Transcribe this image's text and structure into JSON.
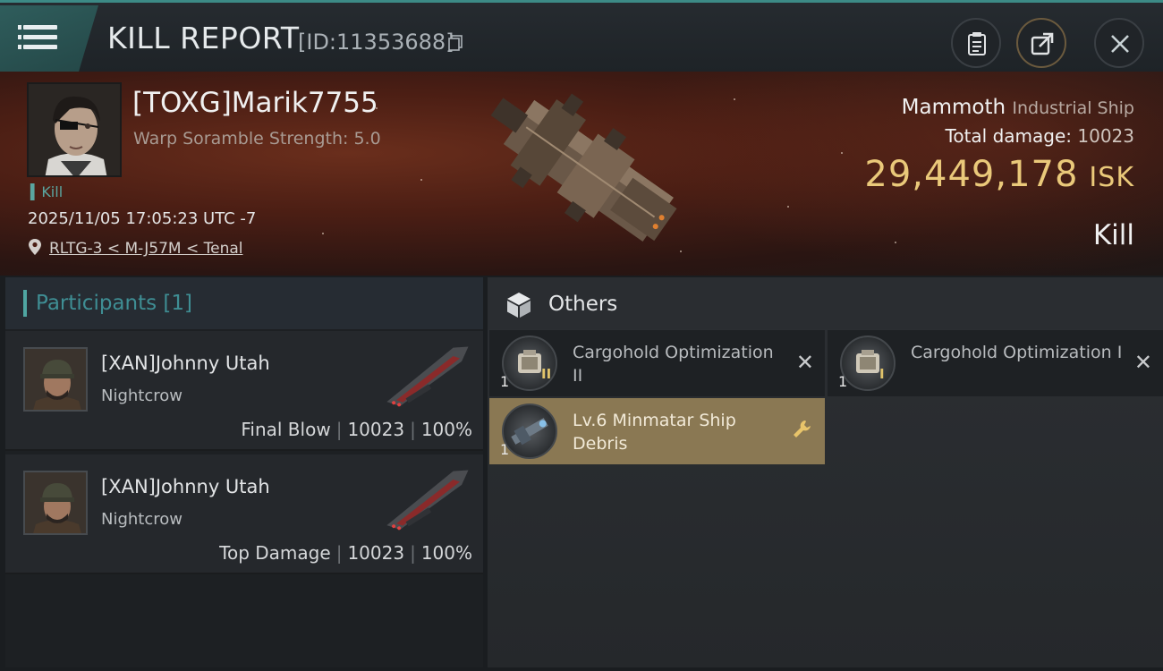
{
  "header": {
    "title": "KILL REPORT",
    "report_id": "[ID:11353688]"
  },
  "victim": {
    "name": "[TOXG]Marik7755",
    "scramble": "Warp Soramble Strength: 5.0",
    "tag": "Kill",
    "timestamp": "2025/11/05 17:05:23 UTC -7",
    "location": "RLTG-3 < M-J57M < Tenal",
    "ship_name": "Mammoth",
    "ship_class": "Industrial Ship",
    "total_damage_label": "Total damage:",
    "total_damage": "10023",
    "isk_value": "29,449,178",
    "isk_unit": "ISK",
    "result": "Kill"
  },
  "participants": {
    "label": "Participants",
    "count": "[1]",
    "rows": [
      {
        "name": "[XAN]Johnny Utah",
        "ship": "Nightcrow",
        "role": "Final Blow",
        "damage": "10023",
        "percent": "100%"
      },
      {
        "name": "[XAN]Johnny Utah",
        "ship": "Nightcrow",
        "role": "Top Damage",
        "damage": "10023",
        "percent": "100%"
      }
    ]
  },
  "others": {
    "label": "Others",
    "items": [
      {
        "name": "Cargohold Optimization II",
        "qty": "1",
        "tier": "II",
        "state": "destroyed"
      },
      {
        "name": "Cargohold Optimization I",
        "qty": "1",
        "tier": "I",
        "state": "destroyed"
      },
      {
        "name": "Lv.6 Minmatar Ship Debris",
        "qty": "1",
        "tier": "",
        "state": "dropped"
      }
    ]
  },
  "colors": {
    "accent_teal": "#3c8a86",
    "isk_gold": "#eac97a",
    "dropped_item_bg": "#8a7853"
  }
}
